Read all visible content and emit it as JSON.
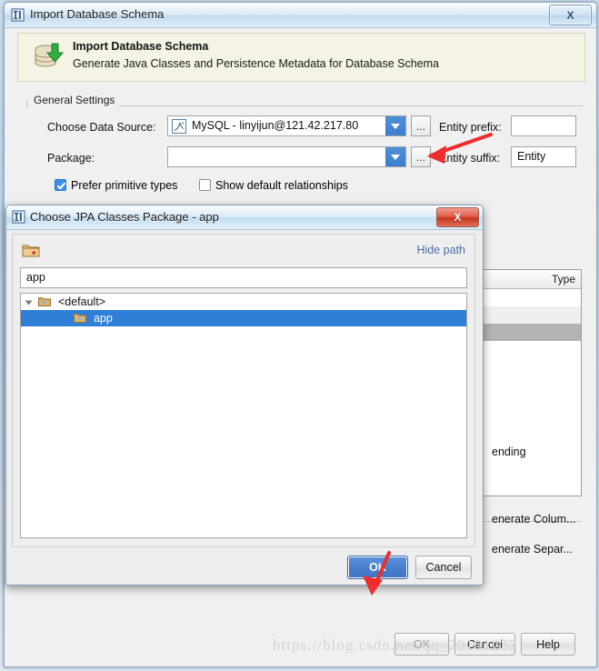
{
  "main_window": {
    "title": "Import Database Schema",
    "close_label": "X",
    "banner": {
      "title": "Import Database Schema",
      "subtitle": "Generate Java Classes and Persistence Metadata for Database Schema",
      "icon": "database-import-icon"
    },
    "group_label": "General Settings",
    "fields": {
      "data_source_label": "Choose Data Source:",
      "data_source_value": "MySQL - linyijun@121.42.217.80",
      "data_source_icon": "mysql-datasource-icon",
      "package_label": "Package:",
      "package_value": "",
      "package_placeholder": "",
      "browse_label": "...",
      "entity_prefix_label": "Entity prefix:",
      "entity_prefix_value": "",
      "entity_suffix_label": "Entity suffix:",
      "entity_suffix_value": "Entity"
    },
    "checkboxes": [
      {
        "label": "Prefer primitive types",
        "checked": true
      },
      {
        "label": "Show default relationships",
        "checked": false
      }
    ],
    "background_table": {
      "column_header": "Type",
      "rows": [
        "",
        "",
        "",
        ""
      ]
    },
    "background_texts": {
      "pending": "ending",
      "generate_columns": "enerate Colum...",
      "generate_separate": "enerate Separ..."
    },
    "buttons": {
      "ok": "OK",
      "cancel": "Cancel",
      "help": "Help"
    }
  },
  "modal": {
    "title": "Choose JPA Classes Package - app",
    "close_label": "X",
    "new_folder_icon": "new-folder-icon",
    "hide_path_label": "Hide path",
    "path_value": "app",
    "tree": [
      {
        "label": "<default>",
        "depth": 0,
        "expanded": true,
        "selected": false
      },
      {
        "label": "app",
        "depth": 1,
        "expanded": false,
        "selected": true
      }
    ],
    "buttons": {
      "ok": "OK",
      "cancel": "Cancel"
    }
  },
  "watermark": "https://blog.csdn.net/qq_20101237",
  "colors": {
    "accent_blue": "#3f74c4",
    "selection_blue": "#2f7fd6",
    "annotation_red": "#ef2f2f",
    "banner_bg": "#f4f3e4"
  }
}
